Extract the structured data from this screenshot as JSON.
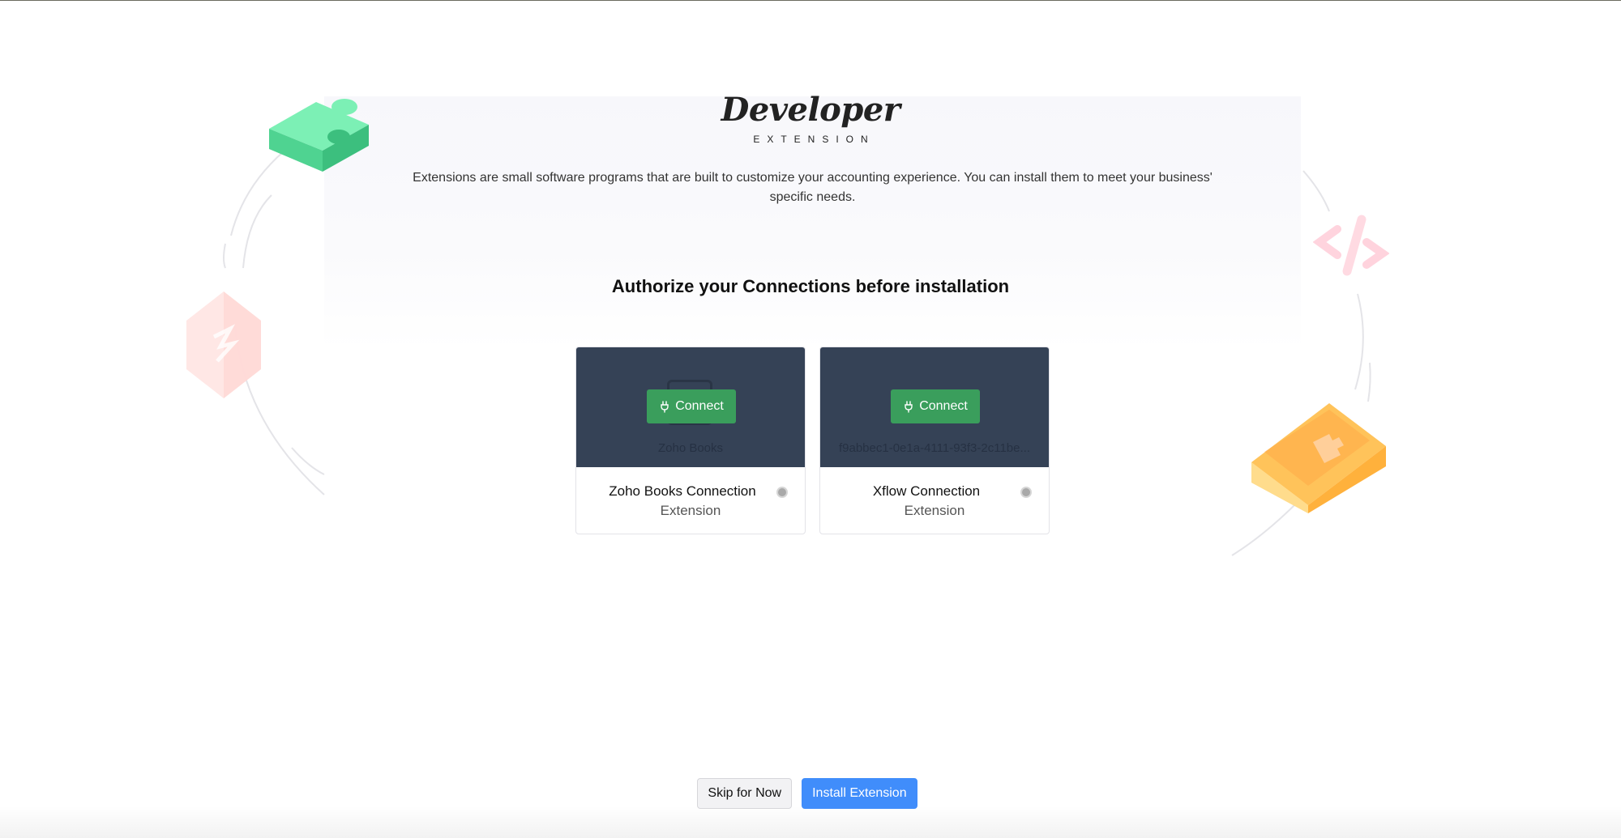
{
  "brand": {
    "title": "Developer",
    "subtitle": "EXTENSION"
  },
  "description": "Extensions are small software programs that are built to customize your accounting experience. You can install them to meet your business' specific needs.",
  "section_title": "Authorize your Connections before installation",
  "connections": [
    {
      "service_label": "Zoho Books",
      "connect_label": "Connect",
      "name": "Zoho Books Connection",
      "type": "Extension"
    },
    {
      "service_label": "f9abbec1-0e1a-4111-93f3-2c11be...",
      "connect_label": "Connect",
      "name": "Xflow Connection",
      "type": "Extension"
    }
  ],
  "actions": {
    "skip_label": "Skip for Now",
    "install_label": "Install Extension"
  },
  "colors": {
    "card_header": "#354256",
    "connect_button": "#3a9e5c",
    "primary_button": "#408dfb",
    "puzzle_green": "#5fe3a1",
    "box_orange": "#ffb347",
    "hex_pink": "#ffd3d3",
    "code_pink": "#ffc8d6"
  },
  "icons": {
    "connect": "plug-icon",
    "decor_left_top": "puzzle-piece-icon",
    "decor_left_mid": "hexagon-bolt-icon",
    "decor_right_top": "code-percent-icon",
    "decor_right_bottom": "puzzle-box-icon"
  }
}
